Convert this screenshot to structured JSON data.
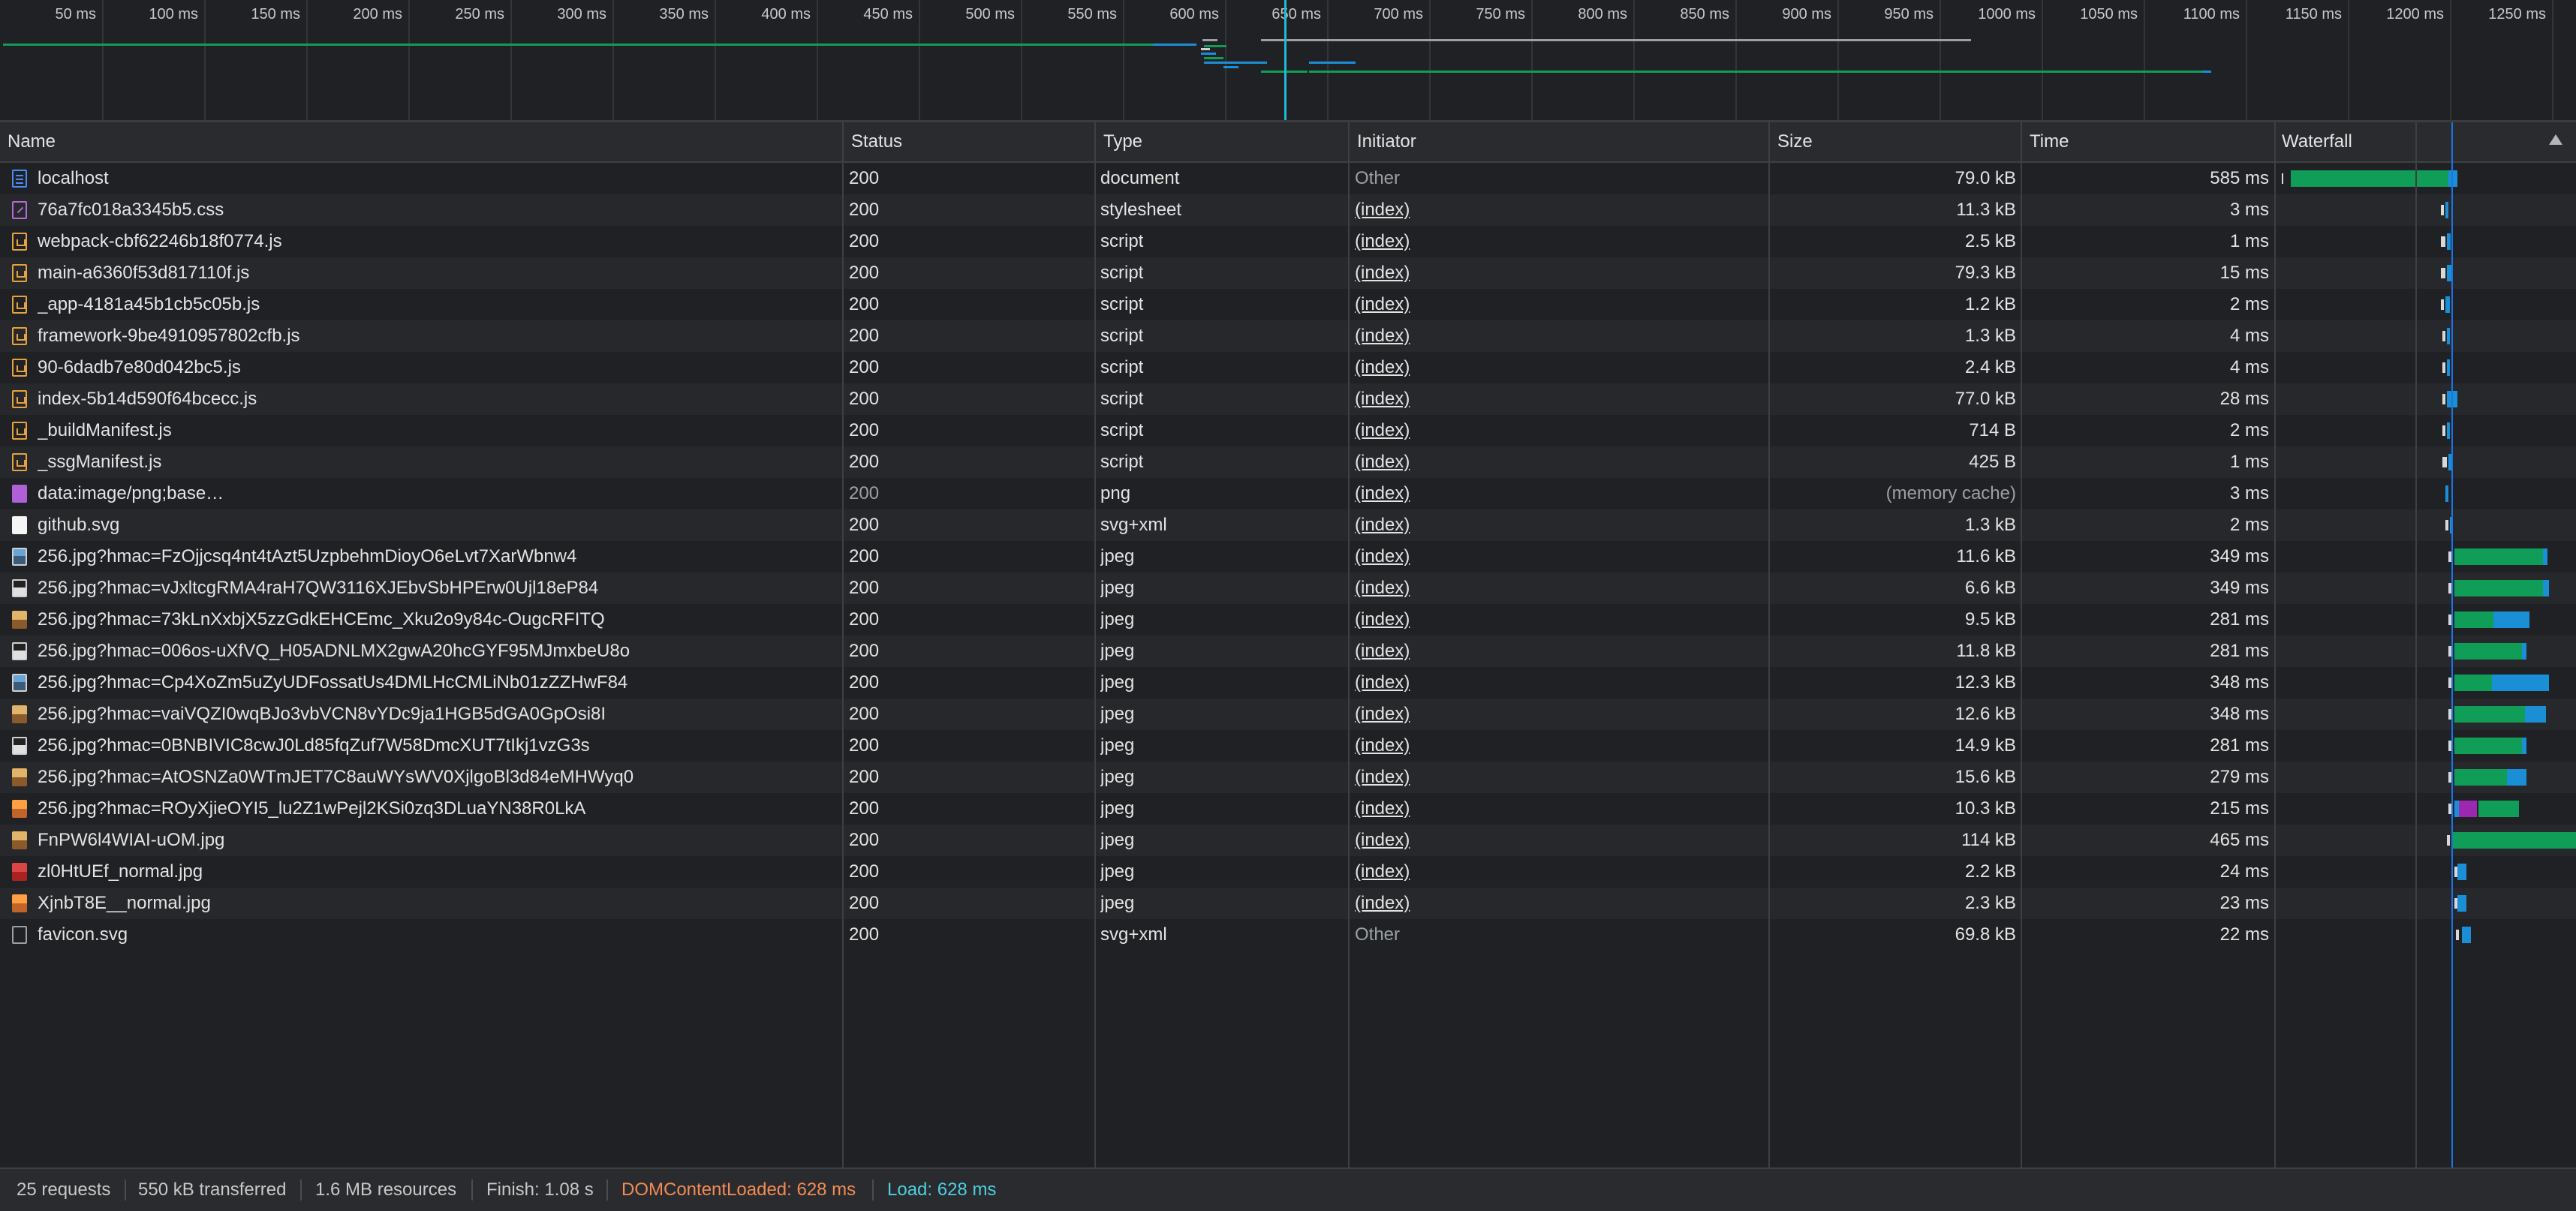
{
  "overview": {
    "ticks": [
      "50 ms",
      "100 ms",
      "150 ms",
      "200 ms",
      "250 ms",
      "300 ms",
      "350 ms",
      "400 ms",
      "450 ms",
      "500 ms",
      "550 ms",
      "600 ms",
      "650 ms",
      "700 ms",
      "750 ms",
      "800 ms",
      "850 ms",
      "900 ms",
      "950 ms",
      "1000 ms",
      "1050 ms",
      "1100 ms",
      "1150 ms",
      "1200 ms",
      "1250 ms"
    ]
  },
  "columns": {
    "name": "Name",
    "status": "Status",
    "type": "Type",
    "initiator": "Initiator",
    "size": "Size",
    "time": "Time",
    "waterfall": "Waterfall"
  },
  "rows": [
    {
      "name": "localhost",
      "status": "200",
      "type": "document",
      "initiator": "Other",
      "size": "79.0 kB",
      "time": "585 ms",
      "icon": "document-icon"
    },
    {
      "name": "76a7fc018a3345b5.css",
      "status": "200",
      "type": "stylesheet",
      "initiator": "(index)",
      "size": "11.3 kB",
      "time": "3 ms",
      "icon": "stylesheet-icon"
    },
    {
      "name": "webpack-cbf62246b18f0774.js",
      "status": "200",
      "type": "script",
      "initiator": "(index)",
      "size": "2.5 kB",
      "time": "1 ms",
      "icon": "script-icon"
    },
    {
      "name": "main-a6360f53d817110f.js",
      "status": "200",
      "type": "script",
      "initiator": "(index)",
      "size": "79.3 kB",
      "time": "15 ms",
      "icon": "script-icon"
    },
    {
      "name": "_app-4181a45b1cb5c05b.js",
      "status": "200",
      "type": "script",
      "initiator": "(index)",
      "size": "1.2 kB",
      "time": "2 ms",
      "icon": "script-icon"
    },
    {
      "name": "framework-9be4910957802cfb.js",
      "status": "200",
      "type": "script",
      "initiator": "(index)",
      "size": "1.3 kB",
      "time": "4 ms",
      "icon": "script-icon"
    },
    {
      "name": "90-6dadb7e80d042bc5.js",
      "status": "200",
      "type": "script",
      "initiator": "(index)",
      "size": "2.4 kB",
      "time": "4 ms",
      "icon": "script-icon"
    },
    {
      "name": "index-5b14d590f64bcecc.js",
      "status": "200",
      "type": "script",
      "initiator": "(index)",
      "size": "77.0 kB",
      "time": "28 ms",
      "icon": "script-icon"
    },
    {
      "name": "_buildManifest.js",
      "status": "200",
      "type": "script",
      "initiator": "(index)",
      "size": "714 B",
      "time": "2 ms",
      "icon": "script-icon"
    },
    {
      "name": "_ssgManifest.js",
      "status": "200",
      "type": "script",
      "initiator": "(index)",
      "size": "425 B",
      "time": "1 ms",
      "icon": "script-icon"
    },
    {
      "name": "data:image/png;base…",
      "status": "200",
      "type": "png",
      "initiator": "(index)",
      "size": "(memory cache)",
      "time": "3 ms",
      "icon": "png-icon"
    },
    {
      "name": "github.svg",
      "status": "200",
      "type": "svg+xml",
      "initiator": "(index)",
      "size": "1.3 kB",
      "time": "2 ms",
      "icon": "svg-icon"
    },
    {
      "name": "256.jpg?hmac=FzOjjcsq4nt4tAzt5UzpbehmDioyO6eLvt7XarWbnw4",
      "status": "200",
      "type": "jpeg",
      "initiator": "(index)",
      "size": "11.6 kB",
      "time": "349 ms",
      "icon": "image-icon"
    },
    {
      "name": "256.jpg?hmac=vJxltcgRMA4raH7QW3116XJEbvSbHPErw0Ujl18eP84",
      "status": "200",
      "type": "jpeg",
      "initiator": "(index)",
      "size": "6.6 kB",
      "time": "349 ms",
      "icon": "image-icon"
    },
    {
      "name": "256.jpg?hmac=73kLnXxbjX5zzGdkEHCEmc_Xku2o9y84c-OugcRFITQ",
      "status": "200",
      "type": "jpeg",
      "initiator": "(index)",
      "size": "9.5 kB",
      "time": "281 ms",
      "icon": "image-icon"
    },
    {
      "name": "256.jpg?hmac=006os-uXfVQ_H05ADNLMX2gwA20hcGYF95MJmxbeU8o",
      "status": "200",
      "type": "jpeg",
      "initiator": "(index)",
      "size": "11.8 kB",
      "time": "281 ms",
      "icon": "image-icon"
    },
    {
      "name": "256.jpg?hmac=Cp4XoZm5uZyUDFossatUs4DMLHcCMLiNb01zZZHwF84",
      "status": "200",
      "type": "jpeg",
      "initiator": "(index)",
      "size": "12.3 kB",
      "time": "348 ms",
      "icon": "image-icon"
    },
    {
      "name": "256.jpg?hmac=vaiVQZI0wqBJo3vbVCN8vYDc9ja1HGB5dGA0GpOsi8I",
      "status": "200",
      "type": "jpeg",
      "initiator": "(index)",
      "size": "12.6 kB",
      "time": "348 ms",
      "icon": "image-icon"
    },
    {
      "name": "256.jpg?hmac=0BNBIVIC8cwJ0Ld85fqZuf7W58DmcXUT7tIkj1vzG3s",
      "status": "200",
      "type": "jpeg",
      "initiator": "(index)",
      "size": "14.9 kB",
      "time": "281 ms",
      "icon": "image-icon"
    },
    {
      "name": "256.jpg?hmac=AtOSNZa0WTmJET7C8auWYsWV0XjlgoBl3d84eMHWyq0",
      "status": "200",
      "type": "jpeg",
      "initiator": "(index)",
      "size": "15.6 kB",
      "time": "279 ms",
      "icon": "image-icon"
    },
    {
      "name": "256.jpg?hmac=ROyXjieOYI5_lu2Z1wPejl2KSi0zq3DLuaYN38R0LkA",
      "status": "200",
      "type": "jpeg",
      "initiator": "(index)",
      "size": "10.3 kB",
      "time": "215 ms",
      "icon": "image-icon"
    },
    {
      "name": "FnPW6l4WIAI-uOM.jpg",
      "status": "200",
      "type": "jpeg",
      "initiator": "(index)",
      "size": "114 kB",
      "time": "465 ms",
      "icon": "image-icon"
    },
    {
      "name": "zl0HtUEf_normal.jpg",
      "status": "200",
      "type": "jpeg",
      "initiator": "(index)",
      "size": "2.2 kB",
      "time": "24 ms",
      "icon": "image-icon"
    },
    {
      "name": "XjnbT8E__normal.jpg",
      "status": "200",
      "type": "jpeg",
      "initiator": "(index)",
      "size": "2.3 kB",
      "time": "23 ms",
      "icon": "image-icon"
    },
    {
      "name": "favicon.svg",
      "status": "200",
      "type": "svg+xml",
      "initiator": "Other",
      "size": "69.8 kB",
      "time": "22 ms",
      "icon": "favicon-icon"
    }
  ],
  "status_bar": {
    "requests": "25 requests",
    "transferred": "550 kB transferred",
    "resources": "1.6 MB resources",
    "finish": "Finish: 1.08 s",
    "dom_content_loaded": "DOMContentLoaded: 628 ms",
    "load": "Load: 628 ms"
  },
  "colors": {
    "dom_content_loaded": "#f28b54",
    "load": "#4dd0e1",
    "waiting": "#0f9d58",
    "download": "#1a8fd6",
    "queue": "#9c27b0"
  }
}
